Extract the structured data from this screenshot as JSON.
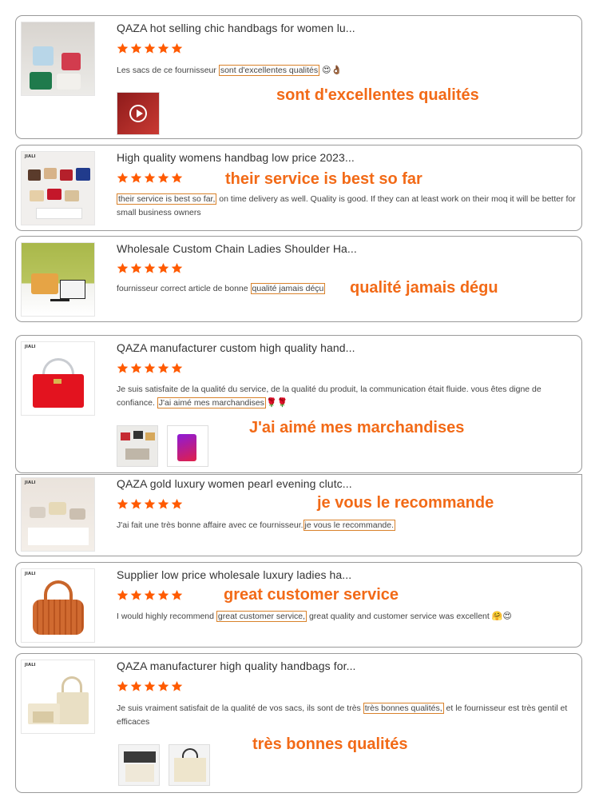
{
  "reviews": [
    {
      "title": "QAZA hot selling chic handbags for women lu...",
      "rating": 5,
      "text_before": "Les sacs de ce fournisseur ",
      "highlight": "sont d'excellentes qualités",
      "text_after": "",
      "emoji": "😍👌🏾",
      "callout": "sont d'excellentes qualités",
      "media": [
        "video"
      ]
    },
    {
      "title": "High quality womens handbag low price 2023...",
      "rating": 5,
      "text_before": "",
      "highlight": "their service is best so far,",
      "text_after": " on time delivery as well. Quality is good. If they can at least work on their moq it will be better for small business owners",
      "emoji": "",
      "callout": "their service is best so far",
      "media": []
    },
    {
      "title": "Wholesale Custom Chain Ladies Shoulder Ha...",
      "rating": 5,
      "text_before": "fournisseur correct article de bonne ",
      "highlight": "qualité jamais déçu",
      "text_after": "",
      "emoji": "",
      "callout": "qualité jamais dégu",
      "media": []
    },
    {
      "title": "QAZA manufacturer custom high quality hand...",
      "rating": 5,
      "text_before": "Je suis satisfaite de la qualité du service, de la qualité du produit, la communication était fluide. vous êtes digne de confiance.",
      "highlight": "J'ai aimé mes marchandises",
      "text_after": "",
      "emoji": "🌹🌹",
      "callout": "J'ai aimé mes marchandises",
      "media": [
        "photo",
        "photo"
      ]
    },
    {
      "title": "QAZA gold luxury women pearl evening clutc...",
      "rating": 5,
      "text_before": "J'ai fait une très bonne affaire avec ce fournisseur.",
      "highlight": "je vous le recommande.",
      "text_after": "",
      "emoji": "",
      "callout": "je vous le recommande",
      "media": []
    },
    {
      "title": "Supplier low price wholesale luxury ladies ha...",
      "rating": 5,
      "text_before": "I would highly recommend ",
      "highlight": "great customer service,",
      "text_after": " great quality and customer service was excellent ",
      "emoji": "🤗😍",
      "callout": "great customer service",
      "media": []
    },
    {
      "title": "QAZA manufacturer high quality handbags for...",
      "rating": 5,
      "text_before": "Je suis vraiment satisfait de la qualité de vos sacs, ils sont de très ",
      "highlight": "très bonnes qualités,",
      "text_after": " et le fournisseur est très gentil et  efficaces",
      "emoji": "",
      "callout": "très bonnes qualités",
      "media": [
        "photo",
        "photo"
      ]
    }
  ],
  "colors": {
    "star": "#ff5a00",
    "callout": "#f26a17",
    "highlight_border": "#d9822b"
  }
}
